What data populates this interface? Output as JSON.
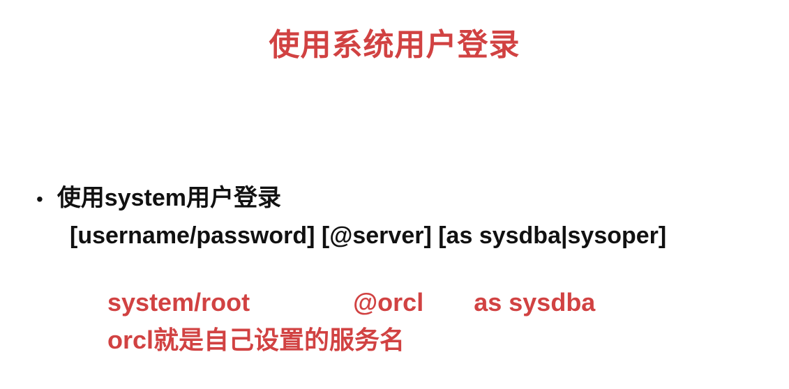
{
  "title": "使用系统用户登录",
  "bullet": "•",
  "line1": "使用system用户登录",
  "line2": "[username/password] [@server] [as sysdba|sysoper]",
  "red_part1": "system/root",
  "red_part2": "@orcl",
  "red_part3": "as sysdba",
  "red_line2": "orcl就是自己设置的服务名"
}
